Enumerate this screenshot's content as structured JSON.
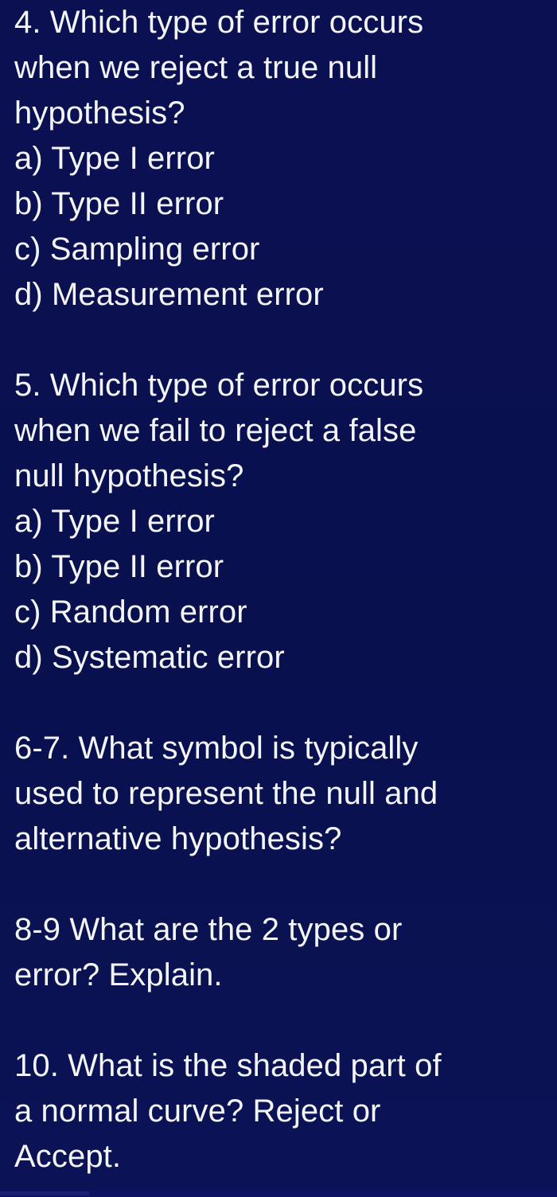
{
  "page": {
    "background_color": "#0a1050",
    "text_color": "#f3f5fa",
    "accent_band_color": "#1b2378",
    "document_type": "quiz-questions"
  },
  "questions": [
    {
      "number": "4",
      "prompt_lines": [
        "4. Which type of error occurs",
        "when we reject a true null",
        "hypothesis?"
      ],
      "options": [
        "a) Type I error",
        "b) Type II error",
        "c) Sampling error",
        "d) Measurement error"
      ]
    },
    {
      "number": "5",
      "prompt_lines": [
        "5. Which type of error occurs",
        "when we fail to reject a false",
        "null hypothesis?"
      ],
      "options": [
        "a) Type I error",
        "b) Type II error",
        "c) Random error",
        "d) Systematic error"
      ]
    },
    {
      "number": "6-7",
      "prompt_lines": [
        "6-7. What symbol is typically",
        "used to represent the null and",
        "alternative hypothesis?"
      ],
      "options": []
    },
    {
      "number": "8-9",
      "prompt_lines": [
        "8-9 What are the 2 types or",
        "error? Explain."
      ],
      "options": []
    },
    {
      "number": "10",
      "prompt_lines": [
        "10. What is the shaded part of",
        "a normal curve? Reject or",
        "Accept."
      ],
      "options": []
    }
  ]
}
